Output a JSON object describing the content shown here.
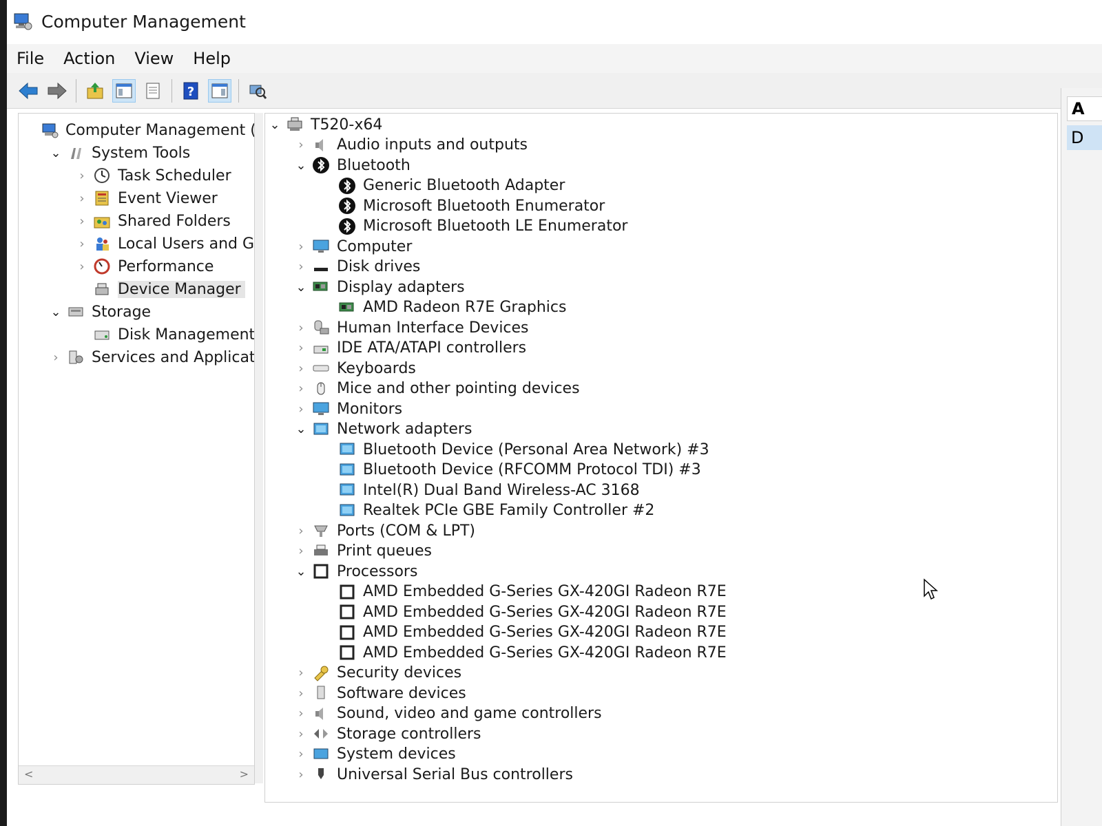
{
  "window": {
    "title": "Computer Management"
  },
  "menu": [
    "File",
    "Action",
    "View",
    "Help"
  ],
  "toolbar": {
    "icons": [
      "back-arrow-icon",
      "forward-arrow-icon",
      "up-folder-icon",
      "show-hide-tree-icon",
      "properties-icon",
      "help-icon",
      "action-pane-icon",
      "scan-hardware-icon"
    ]
  },
  "left_tree": {
    "items": [
      {
        "label": "Computer Management (Local",
        "level": 0,
        "expander": "",
        "icon": "computer-management-icon"
      },
      {
        "label": "System Tools",
        "level": 1,
        "expander": "open",
        "icon": "tools-icon"
      },
      {
        "label": "Task Scheduler",
        "level": 2,
        "expander": "closed",
        "icon": "clock-icon"
      },
      {
        "label": "Event Viewer",
        "level": 2,
        "expander": "closed",
        "icon": "event-viewer-icon"
      },
      {
        "label": "Shared Folders",
        "level": 2,
        "expander": "closed",
        "icon": "shared-folder-icon"
      },
      {
        "label": "Local Users and Groups",
        "level": 2,
        "expander": "closed",
        "icon": "users-icon"
      },
      {
        "label": "Performance",
        "level": 2,
        "expander": "closed",
        "icon": "performance-icon"
      },
      {
        "label": "Device Manager",
        "level": 2,
        "expander": "",
        "icon": "device-manager-icon",
        "selected": true
      },
      {
        "label": "Storage",
        "level": 1,
        "expander": "open",
        "icon": "storage-icon"
      },
      {
        "label": "Disk Management",
        "level": 2,
        "expander": "",
        "icon": "disk-management-icon"
      },
      {
        "label": "Services and Applications",
        "level": 1,
        "expander": "closed",
        "icon": "services-icon"
      }
    ]
  },
  "device_tree": {
    "items": [
      {
        "label": "T520-x64",
        "level": 0,
        "expander": "open",
        "icon": "computer-root-icon"
      },
      {
        "label": "Audio inputs and outputs",
        "level": 1,
        "expander": "closed",
        "icon": "speaker-icon"
      },
      {
        "label": "Bluetooth",
        "level": 1,
        "expander": "open",
        "icon": "bluetooth-icon"
      },
      {
        "label": "Generic Bluetooth Adapter",
        "level": 2,
        "expander": "",
        "icon": "bluetooth-icon"
      },
      {
        "label": "Microsoft Bluetooth Enumerator",
        "level": 2,
        "expander": "",
        "icon": "bluetooth-icon"
      },
      {
        "label": "Microsoft Bluetooth LE Enumerator",
        "level": 2,
        "expander": "",
        "icon": "bluetooth-icon"
      },
      {
        "label": "Computer",
        "level": 1,
        "expander": "closed",
        "icon": "monitor-icon"
      },
      {
        "label": "Disk drives",
        "level": 1,
        "expander": "closed",
        "icon": "disk-drive-icon"
      },
      {
        "label": "Display adapters",
        "level": 1,
        "expander": "open",
        "icon": "display-adapter-icon"
      },
      {
        "label": "AMD Radeon R7E Graphics",
        "level": 2,
        "expander": "",
        "icon": "display-adapter-icon"
      },
      {
        "label": "Human Interface Devices",
        "level": 1,
        "expander": "closed",
        "icon": "hid-icon"
      },
      {
        "label": "IDE ATA/ATAPI controllers",
        "level": 1,
        "expander": "closed",
        "icon": "ide-controller-icon"
      },
      {
        "label": "Keyboards",
        "level": 1,
        "expander": "closed",
        "icon": "keyboard-icon"
      },
      {
        "label": "Mice and other pointing devices",
        "level": 1,
        "expander": "closed",
        "icon": "mouse-icon"
      },
      {
        "label": "Monitors",
        "level": 1,
        "expander": "closed",
        "icon": "monitor-icon"
      },
      {
        "label": "Network adapters",
        "level": 1,
        "expander": "open",
        "icon": "network-adapter-icon"
      },
      {
        "label": "Bluetooth Device (Personal Area Network) #3",
        "level": 2,
        "expander": "",
        "icon": "network-adapter-icon"
      },
      {
        "label": "Bluetooth Device (RFCOMM Protocol TDI) #3",
        "level": 2,
        "expander": "",
        "icon": "network-adapter-icon"
      },
      {
        "label": "Intel(R) Dual Band Wireless-AC 3168",
        "level": 2,
        "expander": "",
        "icon": "network-adapter-icon"
      },
      {
        "label": "Realtek PCIe GBE Family Controller #2",
        "level": 2,
        "expander": "",
        "icon": "network-adapter-icon"
      },
      {
        "label": "Ports (COM & LPT)",
        "level": 1,
        "expander": "closed",
        "icon": "port-icon"
      },
      {
        "label": "Print queues",
        "level": 1,
        "expander": "closed",
        "icon": "printer-icon"
      },
      {
        "label": "Processors",
        "level": 1,
        "expander": "open",
        "icon": "processor-icon"
      },
      {
        "label": "AMD Embedded G-Series GX-420GI Radeon R7E",
        "level": 2,
        "expander": "",
        "icon": "processor-icon"
      },
      {
        "label": "AMD Embedded G-Series GX-420GI Radeon R7E",
        "level": 2,
        "expander": "",
        "icon": "processor-icon"
      },
      {
        "label": "AMD Embedded G-Series GX-420GI Radeon R7E",
        "level": 2,
        "expander": "",
        "icon": "processor-icon"
      },
      {
        "label": "AMD Embedded G-Series GX-420GI Radeon R7E",
        "level": 2,
        "expander": "",
        "icon": "processor-icon"
      },
      {
        "label": "Security devices",
        "level": 1,
        "expander": "closed",
        "icon": "security-icon"
      },
      {
        "label": "Software devices",
        "level": 1,
        "expander": "closed",
        "icon": "software-device-icon"
      },
      {
        "label": "Sound, video and game controllers",
        "level": 1,
        "expander": "closed",
        "icon": "speaker-icon"
      },
      {
        "label": "Storage controllers",
        "level": 1,
        "expander": "closed",
        "icon": "storage-controller-icon"
      },
      {
        "label": "System devices",
        "level": 1,
        "expander": "closed",
        "icon": "system-device-icon"
      },
      {
        "label": "Universal Serial Bus controllers",
        "level": 1,
        "expander": "closed",
        "icon": "usb-icon"
      }
    ]
  },
  "actions_pane": {
    "header": "A",
    "item": "D"
  }
}
